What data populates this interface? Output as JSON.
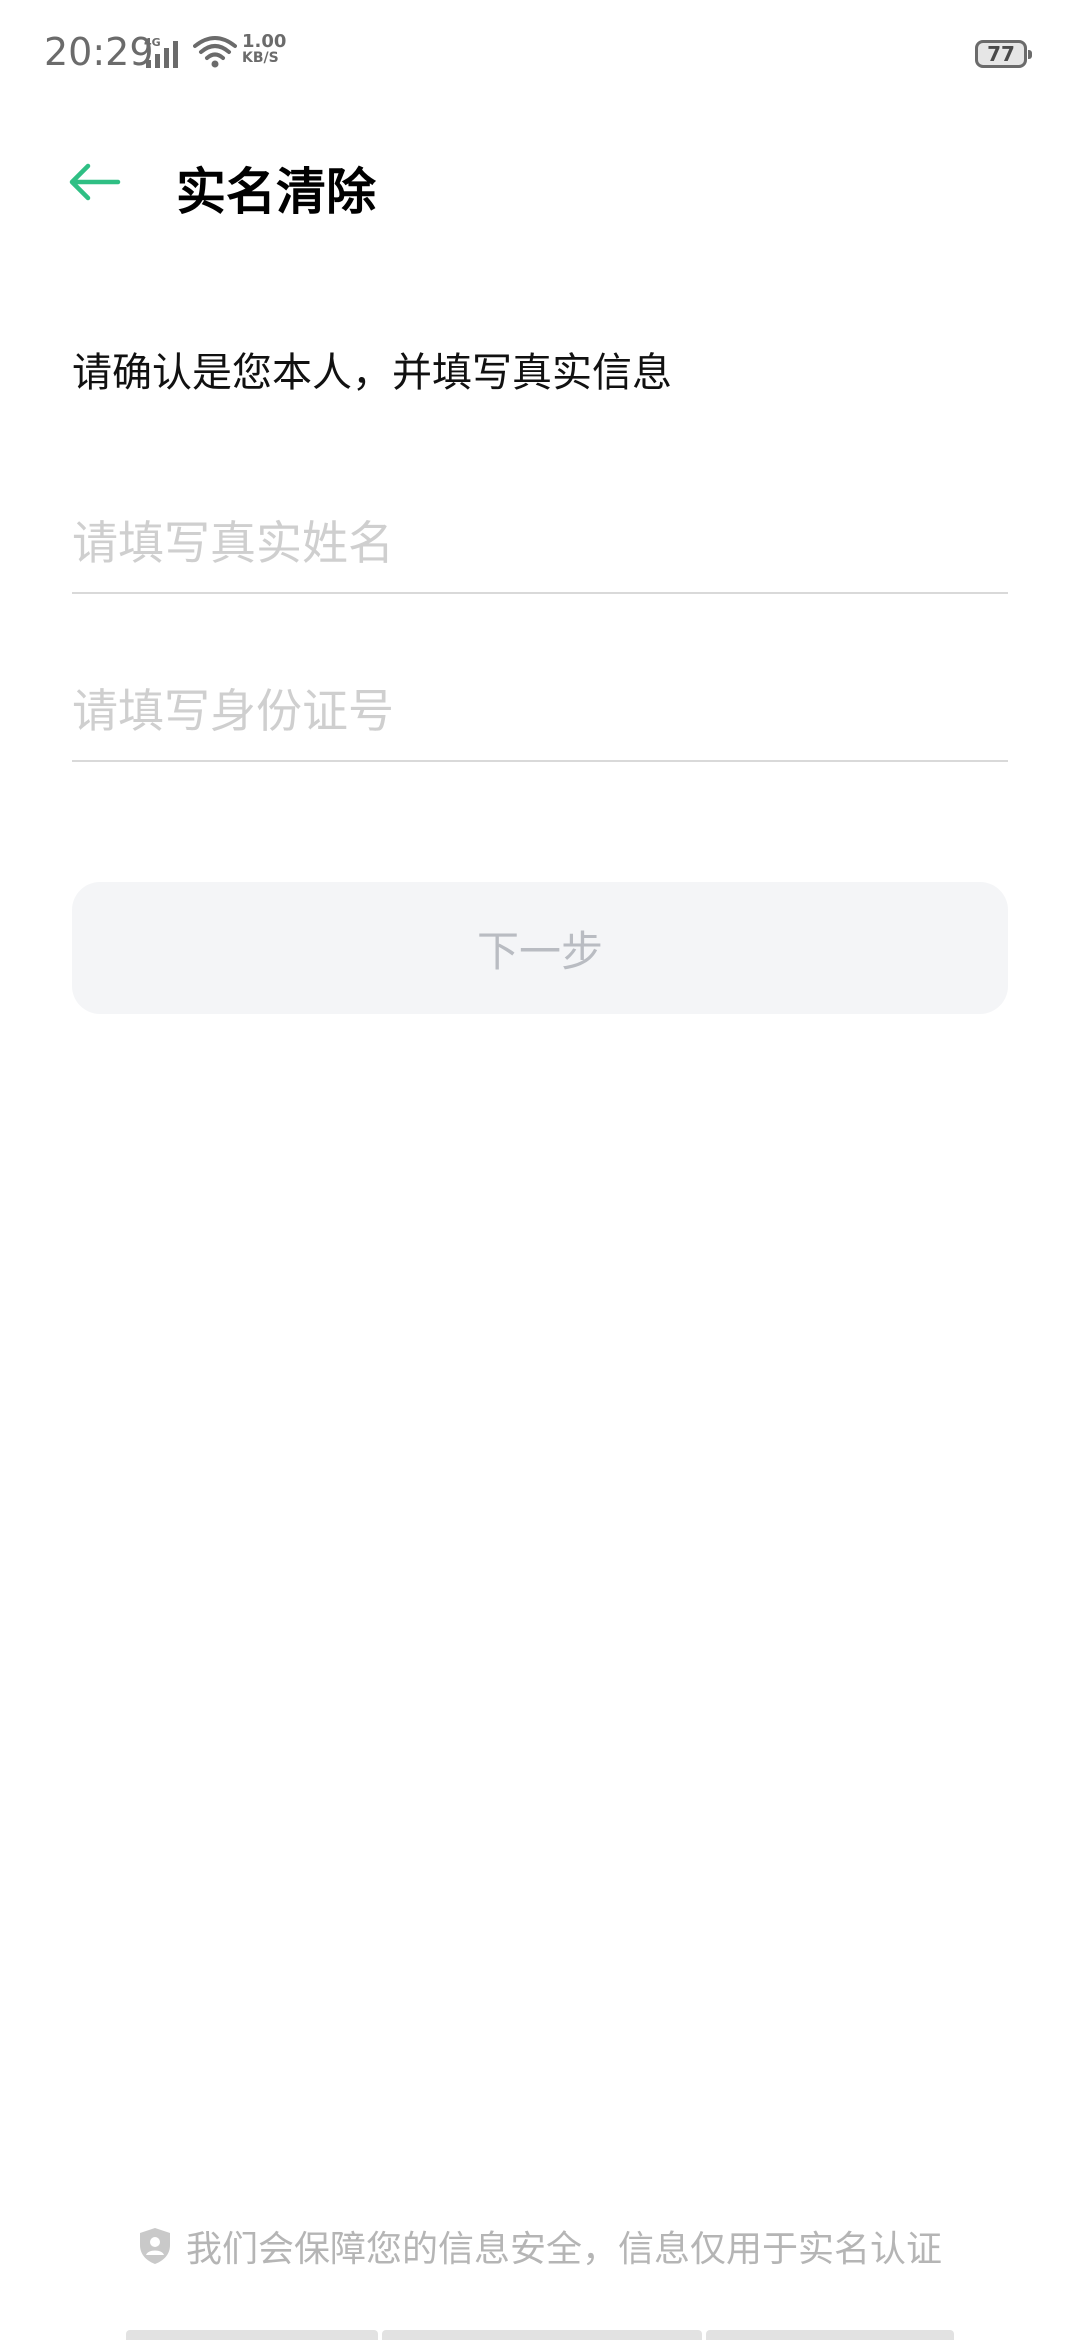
{
  "status_bar": {
    "time": "20:29",
    "network_type": "4G",
    "speed_value": "1.00",
    "speed_unit": "KB/S",
    "battery": "77"
  },
  "header": {
    "title": "实名清除",
    "back_icon": "arrow-left-icon",
    "accent_color": "#2fbf84"
  },
  "form": {
    "instruction": "请确认是您本人，并填写真实信息",
    "name_field": {
      "placeholder": "请填写真实姓名",
      "value": ""
    },
    "id_field": {
      "placeholder": "请填写身份证号",
      "value": ""
    },
    "next_button": "下一步"
  },
  "footer": {
    "icon": "shield-user-icon",
    "text": "我们会保障您的信息安全，信息仅用于实名认证"
  }
}
